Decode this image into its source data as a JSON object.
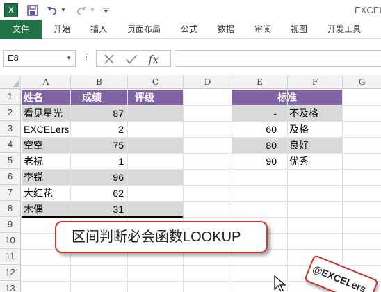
{
  "titlebar": {
    "app_icon_label": "X",
    "window_title": "EXCEL"
  },
  "ribbon": {
    "tabs": [
      "文件",
      "开始",
      "插入",
      "页面布局",
      "公式",
      "数据",
      "审阅",
      "视图",
      "开发工具"
    ]
  },
  "formula_bar": {
    "name_box": "E8",
    "fx_label": "fx",
    "formula": ""
  },
  "columns": [
    "A",
    "B",
    "C",
    "D",
    "E",
    "F",
    "G"
  ],
  "rows": [
    "1",
    "2",
    "3",
    "4",
    "5",
    "6",
    "7",
    "8",
    "9",
    "10",
    "11",
    "12",
    "13"
  ],
  "score_table": {
    "headers": [
      "姓名",
      "成绩",
      "评级"
    ],
    "rows": [
      {
        "name": "看见星光",
        "score": "87",
        "grade": ""
      },
      {
        "name": "EXCELers",
        "score": "2",
        "grade": ""
      },
      {
        "name": "空空",
        "score": "75",
        "grade": ""
      },
      {
        "name": "老祝",
        "score": "1",
        "grade": ""
      },
      {
        "name": "李锐",
        "score": "96",
        "grade": ""
      },
      {
        "name": "大红花",
        "score": "62",
        "grade": ""
      },
      {
        "name": "木偶",
        "score": "31",
        "grade": ""
      }
    ]
  },
  "criteria_table": {
    "header": "标准",
    "rows": [
      {
        "threshold": "-",
        "level": "不及格"
      },
      {
        "threshold": "60",
        "level": "及格"
      },
      {
        "threshold": "80",
        "level": "良好"
      },
      {
        "threshold": "90",
        "level": "优秀"
      }
    ]
  },
  "callout": {
    "text": "区间判断必会函数LOOKUP"
  },
  "stamp": {
    "text": "@EXCELers"
  },
  "colors": {
    "header_fill": "#8064a2",
    "band_fill": "#d9d9d9",
    "file_tab": "#217346",
    "callout_border": "#d9302c"
  }
}
